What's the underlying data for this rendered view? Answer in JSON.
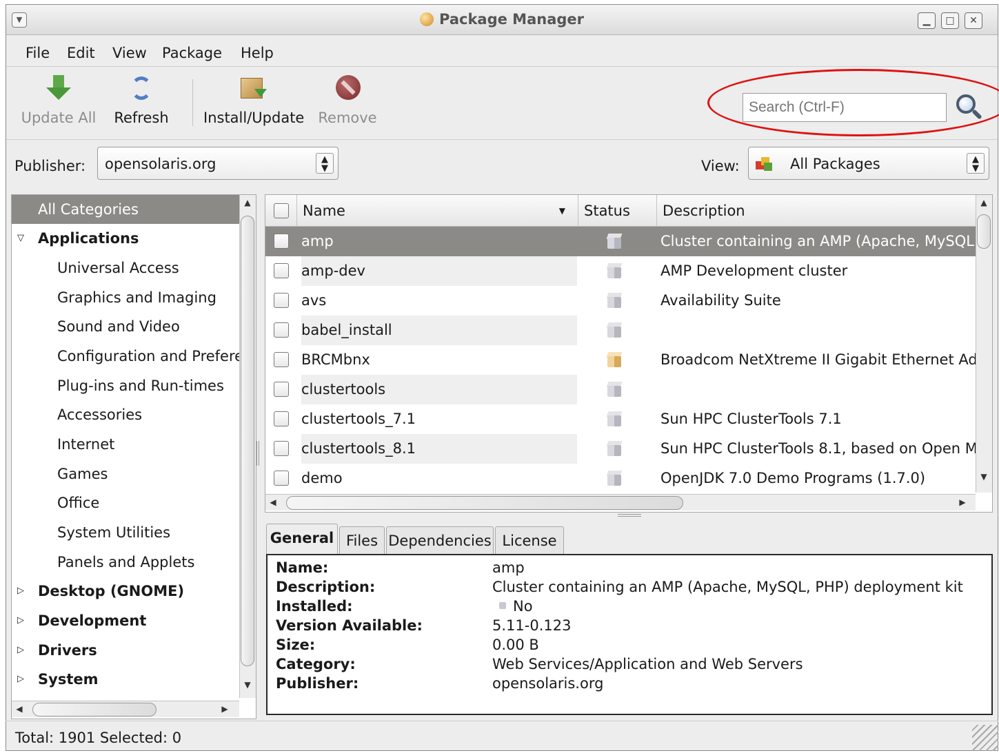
{
  "window": {
    "title": "Package Manager"
  },
  "menu": [
    "File",
    "Edit",
    "View",
    "Package",
    "Help"
  ],
  "toolbar": {
    "update_all": "Update All",
    "refresh": "Refresh",
    "install_update": "Install/Update",
    "remove": "Remove"
  },
  "search": {
    "placeholder": "Search (Ctrl-F)"
  },
  "publisher": {
    "label": "Publisher:",
    "value": "opensolaris.org"
  },
  "view": {
    "label": "View:",
    "value": "All Packages"
  },
  "categories": {
    "all": "All Categories",
    "applications": "Applications",
    "sub": [
      "Universal Access",
      "Graphics and Imaging",
      "Sound and Video",
      "Configuration and Prefere",
      "Plug-ins and Run-times",
      "Accessories",
      "Internet",
      "Games",
      "Office",
      "System Utilities",
      "Panels and Applets"
    ],
    "groups": [
      "Desktop (GNOME)",
      "Development",
      "Drivers",
      "System"
    ]
  },
  "list": {
    "headers": {
      "name": "Name",
      "status": "Status",
      "description": "Description"
    },
    "rows": [
      {
        "name": "amp",
        "description": "Cluster containing an AMP (Apache, MySQL"
      },
      {
        "name": "amp-dev",
        "description": "AMP Development cluster"
      },
      {
        "name": "avs",
        "description": "Availability Suite"
      },
      {
        "name": "babel_install",
        "description": ""
      },
      {
        "name": "BRCMbnx",
        "description": "Broadcom NetXtreme II Gigabit Ethernet Ada|"
      },
      {
        "name": "clustertools",
        "description": ""
      },
      {
        "name": "clustertools_7.1",
        "description": "Sun HPC ClusterTools 7.1"
      },
      {
        "name": "clustertools_8.1",
        "description": "Sun HPC ClusterTools 8.1, based on Open M"
      },
      {
        "name": "demo",
        "description": "OpenJDK 7.0 Demo Programs (1.7.0)"
      }
    ]
  },
  "tabs": [
    "General",
    "Files",
    "Dependencies",
    "License"
  ],
  "details": {
    "labels": [
      "Name:",
      "Description:",
      "Installed:",
      "Version Available:",
      "Size:",
      "Category:",
      "Publisher:"
    ],
    "values": [
      "amp",
      "Cluster containing an AMP (Apache, MySQL, PHP) deployment kit",
      "No",
      "5.11-0.123",
      "0.00 B",
      "Web Services/Application and Web Servers",
      "opensolaris.org"
    ]
  },
  "status": "Total: 1901  Selected: 0",
  "colors": {
    "selection": "#8c8a86",
    "highlight_ellipse": "#e01010"
  }
}
